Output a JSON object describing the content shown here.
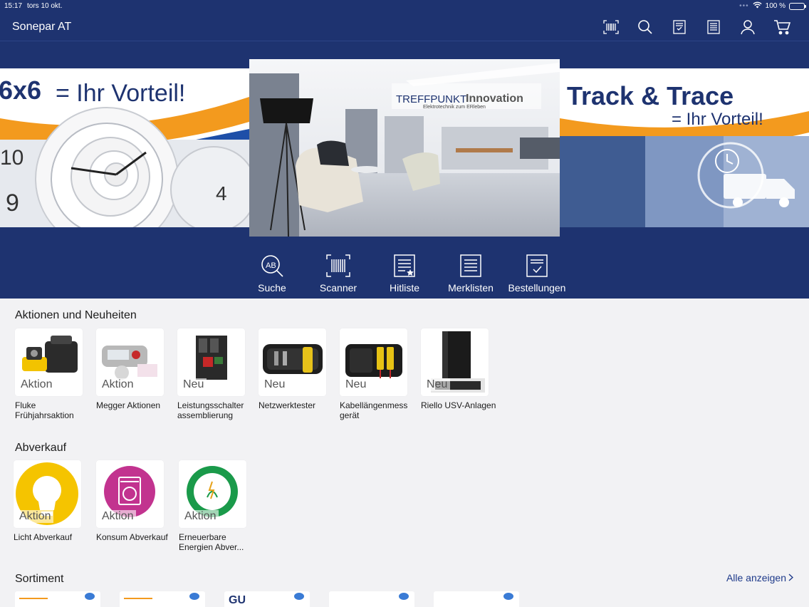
{
  "status": {
    "time": "15:17",
    "date": "tors 10 okt.",
    "battery": "100 %"
  },
  "nav": {
    "title": "Sonepar AT",
    "icons": [
      "barcode-icon",
      "search-icon",
      "orders-icon",
      "list-icon",
      "user-icon",
      "cart-icon"
    ]
  },
  "banner": {
    "left_headline": "6x6",
    "left_tagline": "= Ihr Vorteil!",
    "center_title_a": "TREFFPUNKT",
    "center_title_b": "Innovation",
    "center_sub": "Elektrotechnik  zum ERleben",
    "right_headline": "Track & Trace",
    "right_tagline": "= Ihr Vorteil!"
  },
  "quick_actions": [
    {
      "label": "Suche",
      "icon": "search-text-icon"
    },
    {
      "label": "Scanner",
      "icon": "barcode-icon"
    },
    {
      "label": "Hitliste",
      "icon": "star-list-icon"
    },
    {
      "label": "Merklisten",
      "icon": "list-icon"
    },
    {
      "label": "Bestellungen",
      "icon": "orders-icon"
    }
  ],
  "sections": {
    "aktionen": {
      "title": "Aktionen und Neuheiten",
      "items": [
        {
          "badge": "Aktion",
          "name": "Fluke Frühjahrsaktion"
        },
        {
          "badge": "Aktion",
          "name": "Megger Aktionen"
        },
        {
          "badge": "Neu",
          "name": "Leistungsschalter assemblierung"
        },
        {
          "badge": "Neu",
          "name": "Netzwerktester"
        },
        {
          "badge": "Neu",
          "name": "Kabellängenmess gerät"
        },
        {
          "badge": "Neu",
          "name": "Riello USV-Anlagen"
        }
      ]
    },
    "abverkauf": {
      "title": "Abverkauf",
      "items": [
        {
          "badge": "Aktion",
          "name": "Licht Abverkauf"
        },
        {
          "badge": "Aktion",
          "name": "Konsum Abverkauf"
        },
        {
          "badge": "Aktion",
          "name": "Erneuerbare Energien Abver..."
        }
      ]
    },
    "sortiment": {
      "title": "Sortiment",
      "see_all": "Alle anzeigen",
      "card_logo": "GU"
    }
  },
  "colors": {
    "brand": "#1e3370",
    "accent_orange": "#f39a1e",
    "yellow": "#f5c400",
    "magenta": "#c2338f",
    "green": "#1a9a4a"
  }
}
